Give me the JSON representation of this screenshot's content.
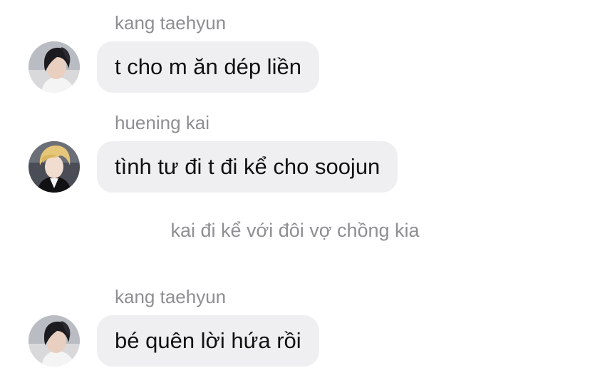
{
  "messages": [
    {
      "sender": "kang taehyun",
      "text": "t cho m ăn dép liền",
      "avatar_icon": "profile-photo-dark-hair"
    },
    {
      "sender": "huening kai",
      "text": "tình tư đi t đi kể cho soojun",
      "avatar_icon": "profile-photo-blond-hair"
    },
    {
      "sender": "kang taehyun",
      "text": "bé quên lời hứa rồi",
      "avatar_icon": "profile-photo-dark-hair"
    }
  ],
  "system_note": "kai đi kể với đôi vợ chồng kia",
  "colors": {
    "bubble": "#efeff1",
    "sender_name": "#8e8e93",
    "text": "#111111"
  }
}
